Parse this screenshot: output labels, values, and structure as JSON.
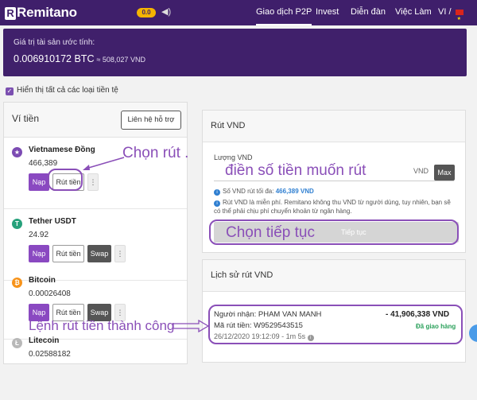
{
  "topbar": {
    "logo": "Remitano",
    "badge": "0.0",
    "nav": [
      "Giao dịch P2P",
      "Invest",
      "Diễn đàn",
      "Việc Làm"
    ],
    "language": "VI"
  },
  "balance": {
    "label": "Giá trị tài sản ước tính:",
    "btc": "0.006910172 BTC",
    "vnd": "≈ 508,027 VND"
  },
  "show_all_label": "Hiển thị tất cả các loại tiền tệ",
  "wallet": {
    "title": "Ví tiền",
    "support_button": "Liên hệ hỗ trợ",
    "deposit_label": "Nạp",
    "withdraw_label": "Rút tiền",
    "swap_label": "Swap",
    "more_label": "⋮",
    "coins": [
      {
        "name": "Vietnamese Đồng",
        "amount": "466,389",
        "icon": "star-icon",
        "color": "#7c4bb3"
      },
      {
        "name": "Tether USDT",
        "amount": "24.92",
        "icon": "tether-icon",
        "color": "#26a17b"
      },
      {
        "name": "Bitcoin",
        "amount": "0.00026408",
        "icon": "bitcoin-icon",
        "color": "#f7931a"
      },
      {
        "name": "Litecoin",
        "amount": "0.02588182",
        "icon": "litecoin-icon",
        "color": "#b8b8b8"
      }
    ]
  },
  "withdraw": {
    "title": "Rút VND",
    "amount_label": "Lượng VND",
    "unit": "VND",
    "max_label": "Max",
    "max_info_prefix": "Số VND rút tối đa:",
    "max_info_value": "466,389 VND",
    "fee_info": "Rút VND là miễn phí. Remitano không thu VND từ người dùng, tuy nhiên, bạn sẽ có thể phải chịu phí chuyển khoản từ ngân hàng.",
    "continue_label": "Tiếp tục"
  },
  "history": {
    "title": "Lịch sử rút VND",
    "recipient": "Người nhận: PHAM VAN MANH",
    "amount": "- 41,906,338 VND",
    "code": "Mã rút tiền: W9529543515",
    "status": "Đã giao hàng",
    "time": "26/12/2020 19:12:09 - 1m 5s"
  },
  "annotations": {
    "choose_withdraw": "Chọn rút .",
    "enter_amount": "điền số tiền muốn rút",
    "choose_continue": "Chọn tiếp tục",
    "success": "Lệnh rút tiền thành công"
  }
}
